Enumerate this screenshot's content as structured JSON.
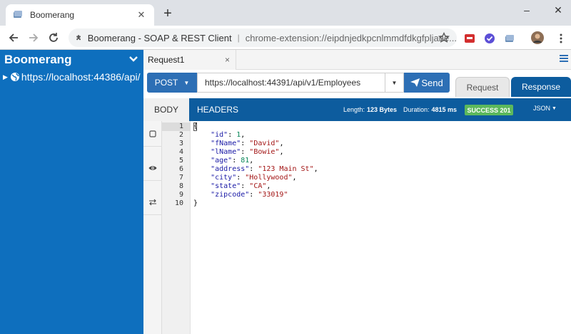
{
  "browser": {
    "tab_title": "Boomerang",
    "tab_close": "✕",
    "new_tab": "+",
    "window_controls": [
      "–",
      "☐",
      "✕"
    ],
    "omnibox": {
      "site_name": "Boomerang - SOAP & REST Client",
      "separator": "|",
      "url": "chrome-extension://eipdnjedkpcnlmmdfdkgfpljane..."
    },
    "icons": [
      "back-icon",
      "forward-icon",
      "reload-icon",
      "extension-icon",
      "star-icon",
      "menu-icon"
    ]
  },
  "sidebar": {
    "title": "Boomerang",
    "tree": [
      {
        "label": "https://localhost:44386/api/",
        "collapsed": true
      }
    ]
  },
  "request_tabs": [
    {
      "label": "Request1",
      "close": "×"
    }
  ],
  "request": {
    "method": "POST",
    "url": "https://localhost:44391/api/v1/Employees",
    "send_label": "Send",
    "request_tab": "Request",
    "response_tab": "Response"
  },
  "response": {
    "body_tab": "BODY",
    "headers_tab": "HEADERS",
    "length_label": "Length:",
    "length_value": "123 Bytes",
    "duration_label": "Duration:",
    "duration_value": "4815 ms",
    "status": "SUCCESS 201",
    "format": "JSON",
    "colors": {
      "success": "#5cb85c",
      "accent": "#0d5c9e",
      "sidebar": "#0e6fbe"
    }
  },
  "editor": {
    "line_numbers": [
      "1",
      "2",
      "3",
      "4",
      "5",
      "6",
      "7",
      "8",
      "9",
      "10"
    ],
    "lines": [
      [
        {
          "t": "{",
          "c": "p"
        }
      ],
      [
        {
          "t": "    ",
          "c": "p"
        },
        {
          "t": "\"id\"",
          "c": "k"
        },
        {
          "t": ": ",
          "c": "p"
        },
        {
          "t": "1",
          "c": "n"
        },
        {
          "t": ",",
          "c": "p"
        }
      ],
      [
        {
          "t": "    ",
          "c": "p"
        },
        {
          "t": "\"fName\"",
          "c": "k"
        },
        {
          "t": ": ",
          "c": "p"
        },
        {
          "t": "\"David\"",
          "c": "s"
        },
        {
          "t": ",",
          "c": "p"
        }
      ],
      [
        {
          "t": "    ",
          "c": "p"
        },
        {
          "t": "\"lName\"",
          "c": "k"
        },
        {
          "t": ": ",
          "c": "p"
        },
        {
          "t": "\"Bowie\"",
          "c": "s"
        },
        {
          "t": ",",
          "c": "p"
        }
      ],
      [
        {
          "t": "    ",
          "c": "p"
        },
        {
          "t": "\"age\"",
          "c": "k"
        },
        {
          "t": ": ",
          "c": "p"
        },
        {
          "t": "81",
          "c": "n"
        },
        {
          "t": ",",
          "c": "p"
        }
      ],
      [
        {
          "t": "    ",
          "c": "p"
        },
        {
          "t": "\"address\"",
          "c": "k"
        },
        {
          "t": ": ",
          "c": "p"
        },
        {
          "t": "\"123 Main St\"",
          "c": "s"
        },
        {
          "t": ",",
          "c": "p"
        }
      ],
      [
        {
          "t": "    ",
          "c": "p"
        },
        {
          "t": "\"city\"",
          "c": "k"
        },
        {
          "t": ": ",
          "c": "p"
        },
        {
          "t": "\"Hollywood\"",
          "c": "s"
        },
        {
          "t": ",",
          "c": "p"
        }
      ],
      [
        {
          "t": "    ",
          "c": "p"
        },
        {
          "t": "\"state\"",
          "c": "k"
        },
        {
          "t": ": ",
          "c": "p"
        },
        {
          "t": "\"CA\"",
          "c": "s"
        },
        {
          "t": ",",
          "c": "p"
        }
      ],
      [
        {
          "t": "    ",
          "c": "p"
        },
        {
          "t": "\"zipcode\"",
          "c": "k"
        },
        {
          "t": ": ",
          "c": "p"
        },
        {
          "t": "\"33019\"",
          "c": "s"
        }
      ],
      [
        {
          "t": "}",
          "c": "p"
        }
      ]
    ],
    "tools": [
      "checkbox-icon",
      "eye-icon",
      "swap-icon"
    ]
  }
}
